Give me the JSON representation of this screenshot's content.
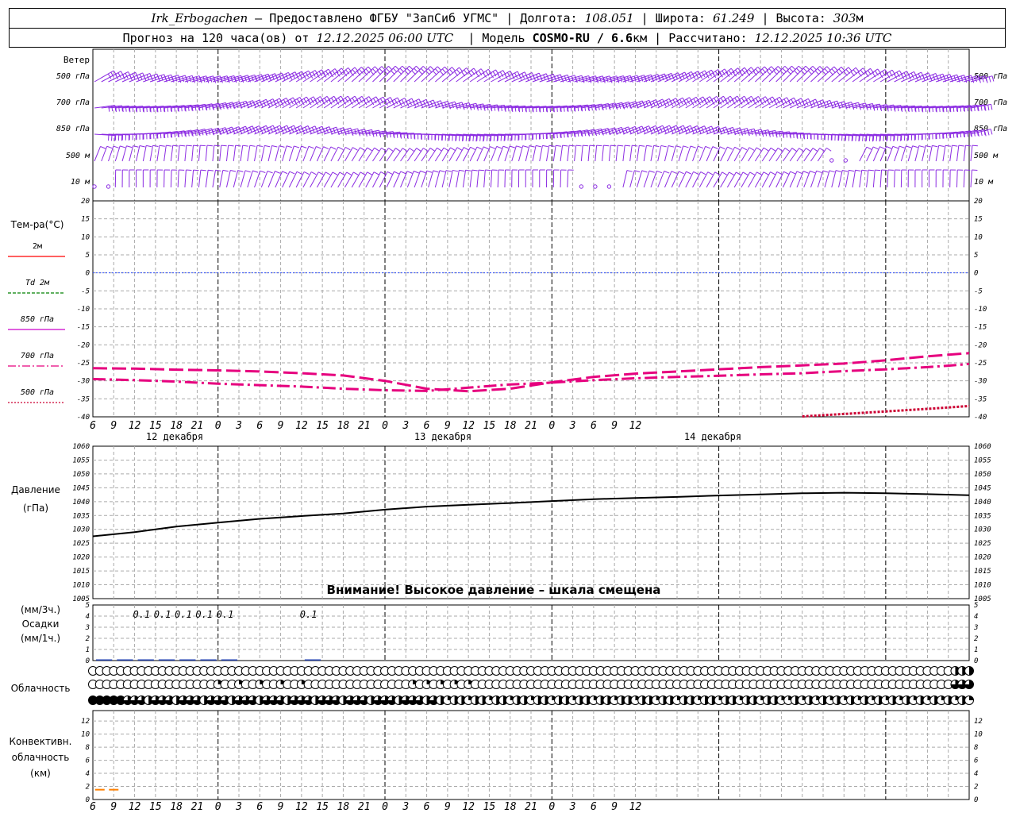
{
  "header": {
    "station": "Irk_Erbogachen",
    "dash": "—",
    "provider": "Предоставлено ФГБУ \"ЗапСиб УГМС\"",
    "lon_label": "Долгота:",
    "lon": "108.051",
    "lat_label": "Широта:",
    "lat": "61.249",
    "alt_label": "Высота:",
    "alt": "303",
    "alt_unit": "м",
    "forecast_prefix": "Прогноз на 120 часа(ов) от",
    "forecast_from": "12.12.2025 06:00 UTC",
    "model_label": "Модель",
    "model": "COSMO-RU / 6.6",
    "model_unit": "км",
    "calc_label": "Рассчитано:",
    "calc_time": "12.12.2025 10:36 UTC"
  },
  "panels": {
    "wind": {
      "title": "Ветер",
      "levels": [
        "500 гПа",
        "700 гПа",
        "850 гПа",
        "500 м",
        "10 м"
      ],
      "color": "#8b2be2"
    },
    "temperature": {
      "title": "Тем-ра(°C)",
      "ylim": [
        -40,
        20
      ],
      "ticks": [
        "20",
        "15",
        "10",
        "5",
        "0",
        "-5",
        "-10",
        "-15",
        "-20",
        "-25",
        "-30",
        "-35",
        "-40"
      ],
      "legend": [
        {
          "label": "2м",
          "color": "#ff0000",
          "dash": "solid"
        },
        {
          "label": "Td  2м",
          "color": "#008000",
          "dash": "dashed"
        },
        {
          "label": "850 гПа",
          "color": "#cc00cc",
          "dash": "solid"
        },
        {
          "label": "700 гПа",
          "color": "#e6007e",
          "dash": "dashdot"
        },
        {
          "label": "500 гПа",
          "color": "#cc0033",
          "dash": "dotted"
        }
      ]
    },
    "pressure": {
      "title": "Давление",
      "unit": "(гПа)",
      "ylim": [
        1005,
        1060
      ],
      "ticks": [
        "1060",
        "1055",
        "1050",
        "1045",
        "1040",
        "1035",
        "1030",
        "1025",
        "1020",
        "1015",
        "1010",
        "1005"
      ],
      "warning": "Внимание! Высокое давление – шкала смещена"
    },
    "precip": {
      "unit3": "(мм/3ч.)",
      "title": "Осадки",
      "unit1": "(мм/1ч.)",
      "ticks": [
        "5",
        "4",
        "3",
        "2",
        "1",
        "0"
      ],
      "labels": [
        {
          "hour": 7,
          "text": "0.1"
        },
        {
          "hour": 10,
          "text": "0.1"
        },
        {
          "hour": 13,
          "text": "0.1"
        },
        {
          "hour": 16,
          "text": "0.1"
        },
        {
          "hour": 19,
          "text": "0.1"
        },
        {
          "hour": 31,
          "text": "0.1"
        }
      ]
    },
    "cloud": {
      "title": "Облачность"
    },
    "convective": {
      "title1": "Конвективн.",
      "title2": "облачность",
      "unit": "(км)",
      "ticks": [
        "12",
        "10",
        "8",
        "6",
        "4",
        "2",
        "0"
      ]
    }
  },
  "time_axis": {
    "hour_labels": [
      "6",
      "9",
      "12",
      "15",
      "18",
      "21",
      "0",
      "3",
      "6",
      "9",
      "12",
      "15",
      "18",
      "21",
      "0",
      "3",
      "6",
      "9",
      "12",
      "15",
      "18",
      "21",
      "0",
      "3",
      "6",
      "9",
      "12"
    ],
    "days": [
      {
        "label": "12 декабря"
      },
      {
        "label": "13 декабря"
      },
      {
        "label": "14 декабря"
      }
    ]
  },
  "chart_data": [
    {
      "type": "line",
      "title": "Тем-ра(°C)",
      "x_unit": "hours since 12.12.2025 06:00 UTC",
      "ylim": [
        -40,
        20
      ],
      "series": [
        {
          "name": "700 гПа",
          "x": [
            0,
            6,
            12,
            18,
            24,
            30,
            36,
            42,
            48,
            54,
            60,
            66,
            72,
            78,
            84,
            90,
            96,
            102,
            108,
            114,
            120,
            123,
            126
          ],
          "values": [
            -29.5,
            -29.8,
            -30.2,
            -30.8,
            -31.2,
            -31.6,
            -32.2,
            -32.6,
            -32.8,
            -31.9,
            -31.0,
            -30.5,
            -29.8,
            -29.3,
            -28.9,
            -28.6,
            -28.2,
            -27.9,
            -27.3,
            -26.8,
            -26.2,
            -25.8,
            -25.3
          ]
        },
        {
          "name": "850 гПа",
          "x": [
            0,
            6,
            12,
            18,
            24,
            30,
            36,
            42,
            48,
            54,
            60,
            66,
            72,
            78,
            84,
            90,
            96,
            102,
            108,
            114,
            120,
            126
          ],
          "values": [
            -26.5,
            -26.6,
            -26.9,
            -27.1,
            -27.4,
            -27.9,
            -28.5,
            -30.0,
            -32.2,
            -32.9,
            -32.2,
            -30.4,
            -28.9,
            -28.0,
            -27.4,
            -26.8,
            -26.2,
            -25.7,
            -25.2,
            -24.3,
            -23.2,
            -22.3
          ]
        },
        {
          "name": "500 гПа",
          "x": [
            102,
            108,
            114,
            120,
            126
          ],
          "values": [
            -39.9,
            -39.2,
            -38.5,
            -37.8,
            -37.0
          ]
        }
      ]
    },
    {
      "type": "line",
      "title": "Давление",
      "ylim": [
        1005,
        1060
      ],
      "series": [
        {
          "name": "Давление",
          "x": [
            0,
            6,
            12,
            18,
            24,
            30,
            36,
            42,
            48,
            54,
            60,
            66,
            72,
            78,
            84,
            90,
            96,
            102,
            108,
            114,
            120,
            126
          ],
          "values": [
            1027.5,
            1029.0,
            1031.0,
            1032.4,
            1033.8,
            1034.8,
            1035.7,
            1037.1,
            1038.2,
            1038.9,
            1039.5,
            1040.2,
            1040.9,
            1041.3,
            1041.7,
            1042.2,
            1042.6,
            1043.0,
            1043.2,
            1043.0,
            1042.7,
            1042.3
          ]
        }
      ]
    },
    {
      "type": "bar",
      "title": "Осадки",
      "x": [
        0,
        3,
        6,
        9,
        12,
        15,
        18,
        21,
        24,
        27,
        30,
        33,
        36
      ],
      "values": [
        0.05,
        0.05,
        0.05,
        0.05,
        0.05,
        0.05,
        0.05,
        0.0,
        0.0,
        0.0,
        0.05,
        0.0,
        0.0
      ]
    },
    {
      "type": "bar",
      "title": "Конвективн. облачность",
      "x": [
        1,
        3
      ],
      "values": [
        1.5,
        1.5
      ]
    }
  ]
}
